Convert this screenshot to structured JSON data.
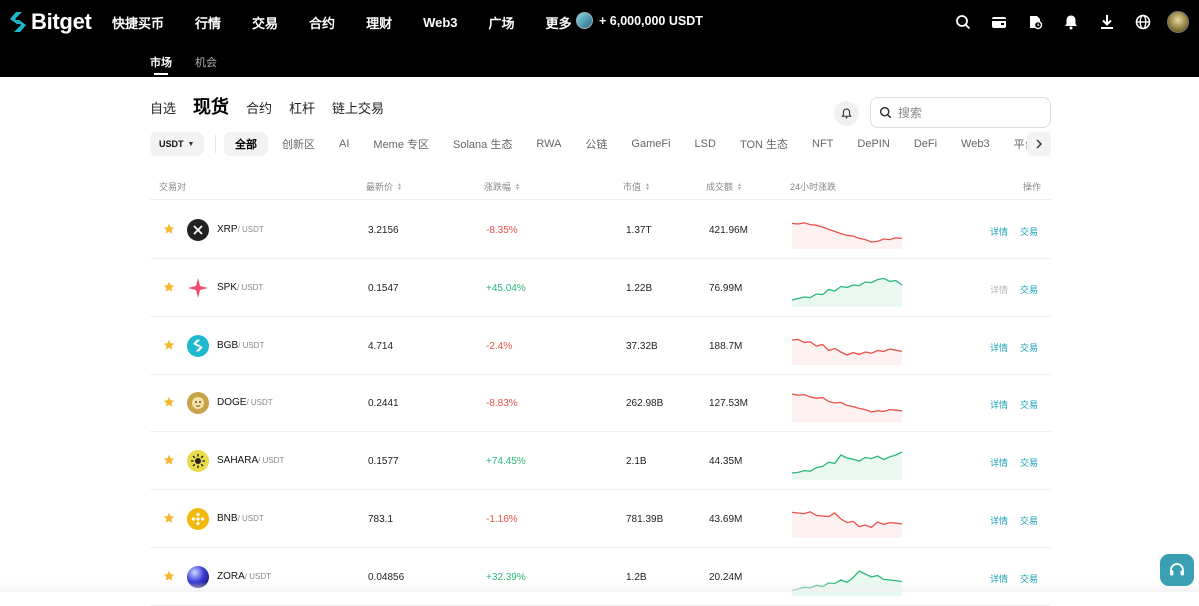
{
  "brand": {
    "name": "Bitget"
  },
  "nav": [
    {
      "label": "快捷买币"
    },
    {
      "label": "行情"
    },
    {
      "label": "交易"
    },
    {
      "label": "合约"
    },
    {
      "label": "理财"
    },
    {
      "label": "Web3"
    },
    {
      "label": "广场"
    },
    {
      "label": "更多"
    }
  ],
  "promo": {
    "label": "+ 6,000,000 USDT"
  },
  "top_icons": [
    "search-icon",
    "wallet-icon",
    "history-icon",
    "bell-icon",
    "download-icon",
    "globe-icon"
  ],
  "subtabs": [
    {
      "label": "市场",
      "active": true
    },
    {
      "label": "机会",
      "active": false
    }
  ],
  "category_tabs": [
    {
      "label": "自选",
      "active": false
    },
    {
      "label": "现货",
      "active": true
    },
    {
      "label": "合约",
      "active": false
    },
    {
      "label": "杠杆",
      "active": false
    },
    {
      "label": "链上交易",
      "active": false
    }
  ],
  "search": {
    "placeholder": "搜索"
  },
  "quote": {
    "selected": "USDT"
  },
  "filters": [
    "全部",
    "创新区",
    "AI",
    "Meme 专区",
    "Solana 生态",
    "RWA",
    "公链",
    "GameFi",
    "LSD",
    "TON 生态",
    "NFT",
    "DePIN",
    "DeFi",
    "Web3",
    "平台币"
  ],
  "active_filter": 0,
  "table": {
    "headers": {
      "pair": "交易对",
      "price": "最新价",
      "change": "涨跌幅",
      "cap": "市值",
      "volume": "成交额",
      "trend": "24小时涨跌",
      "action": "操作"
    },
    "detail_label": "详情",
    "trade_label": "交易",
    "rows": [
      {
        "base": "XRP",
        "quote": "/ USDT",
        "price": "3.2156",
        "change": "-8.35%",
        "direction": "down",
        "cap": "1.37T",
        "volume": "421.96M",
        "icon_color": "#222222",
        "icon": "x-logo-icon",
        "spark": [
          0.72,
          0.7,
          0.74,
          0.68,
          0.66,
          0.6,
          0.52,
          0.45,
          0.38,
          0.32,
          0.3,
          0.22,
          0.18,
          0.1,
          0.12,
          0.2,
          0.18,
          0.24,
          0.22
        ]
      },
      {
        "base": "SPK",
        "quote": "/ USDT",
        "price": "0.1547",
        "change": "+45.04%",
        "direction": "up",
        "cap": "1.22B",
        "volume": "76.99M",
        "icon_color": "#f04a6e",
        "icon": "star-burst-icon",
        "spark": [
          0.1,
          0.15,
          0.2,
          0.18,
          0.3,
          0.28,
          0.45,
          0.4,
          0.55,
          0.52,
          0.6,
          0.58,
          0.7,
          0.68,
          0.78,
          0.82,
          0.72,
          0.75,
          0.6
        ]
      },
      {
        "base": "BGB",
        "quote": "/ USDT",
        "price": "4.714",
        "change": "-2.4%",
        "direction": "down",
        "cap": "37.32B",
        "volume": "188.7M",
        "icon_color": "#1eb8cf",
        "icon": "bitget-logo-icon",
        "spark": [
          0.7,
          0.72,
          0.62,
          0.64,
          0.5,
          0.55,
          0.35,
          0.42,
          0.3,
          0.2,
          0.28,
          0.22,
          0.3,
          0.26,
          0.35,
          0.32,
          0.4,
          0.36,
          0.32
        ]
      },
      {
        "base": "DOGE",
        "quote": "/ USDT",
        "price": "0.2441",
        "change": "-8.83%",
        "direction": "down",
        "cap": "262.98B",
        "volume": "127.53M",
        "icon_color": "#c9a34a",
        "icon": "doge-icon",
        "spark": [
          0.8,
          0.76,
          0.78,
          0.7,
          0.66,
          0.68,
          0.55,
          0.5,
          0.52,
          0.42,
          0.38,
          0.32,
          0.28,
          0.2,
          0.24,
          0.22,
          0.28,
          0.26,
          0.24
        ]
      },
      {
        "base": "SAHARA",
        "quote": "/ USDT",
        "price": "0.1577",
        "change": "+74.45%",
        "direction": "up",
        "cap": "2.1B",
        "volume": "44.35M",
        "icon_color": "#d9c93a",
        "icon": "sun-icon",
        "spark": [
          0.1,
          0.12,
          0.18,
          0.16,
          0.28,
          0.32,
          0.46,
          0.42,
          0.7,
          0.6,
          0.56,
          0.5,
          0.62,
          0.58,
          0.66,
          0.55,
          0.64,
          0.7,
          0.8
        ]
      },
      {
        "base": "BNB",
        "quote": "/ USDT",
        "price": "783.1",
        "change": "-1.16%",
        "direction": "down",
        "cap": "781.39B",
        "volume": "43.69M",
        "icon_color": "#f0b90b",
        "icon": "bnb-logo-icon",
        "spark": [
          0.72,
          0.7,
          0.68,
          0.74,
          0.62,
          0.6,
          0.58,
          0.7,
          0.5,
          0.38,
          0.42,
          0.25,
          0.3,
          0.22,
          0.4,
          0.32,
          0.38,
          0.36,
          0.34
        ]
      },
      {
        "base": "ZORA",
        "quote": "/ USDT",
        "price": "0.04856",
        "change": "+32.39%",
        "direction": "up",
        "cap": "1.2B",
        "volume": "20.24M",
        "icon_color": "#3b3bd8",
        "icon": "orb-icon",
        "spark": [
          0.05,
          0.1,
          0.16,
          0.14,
          0.22,
          0.18,
          0.3,
          0.28,
          0.4,
          0.32,
          0.48,
          0.7,
          0.6,
          0.5,
          0.55,
          0.42,
          0.4,
          0.38,
          0.35
        ]
      }
    ]
  },
  "support": {
    "icon": "headset-icon"
  }
}
